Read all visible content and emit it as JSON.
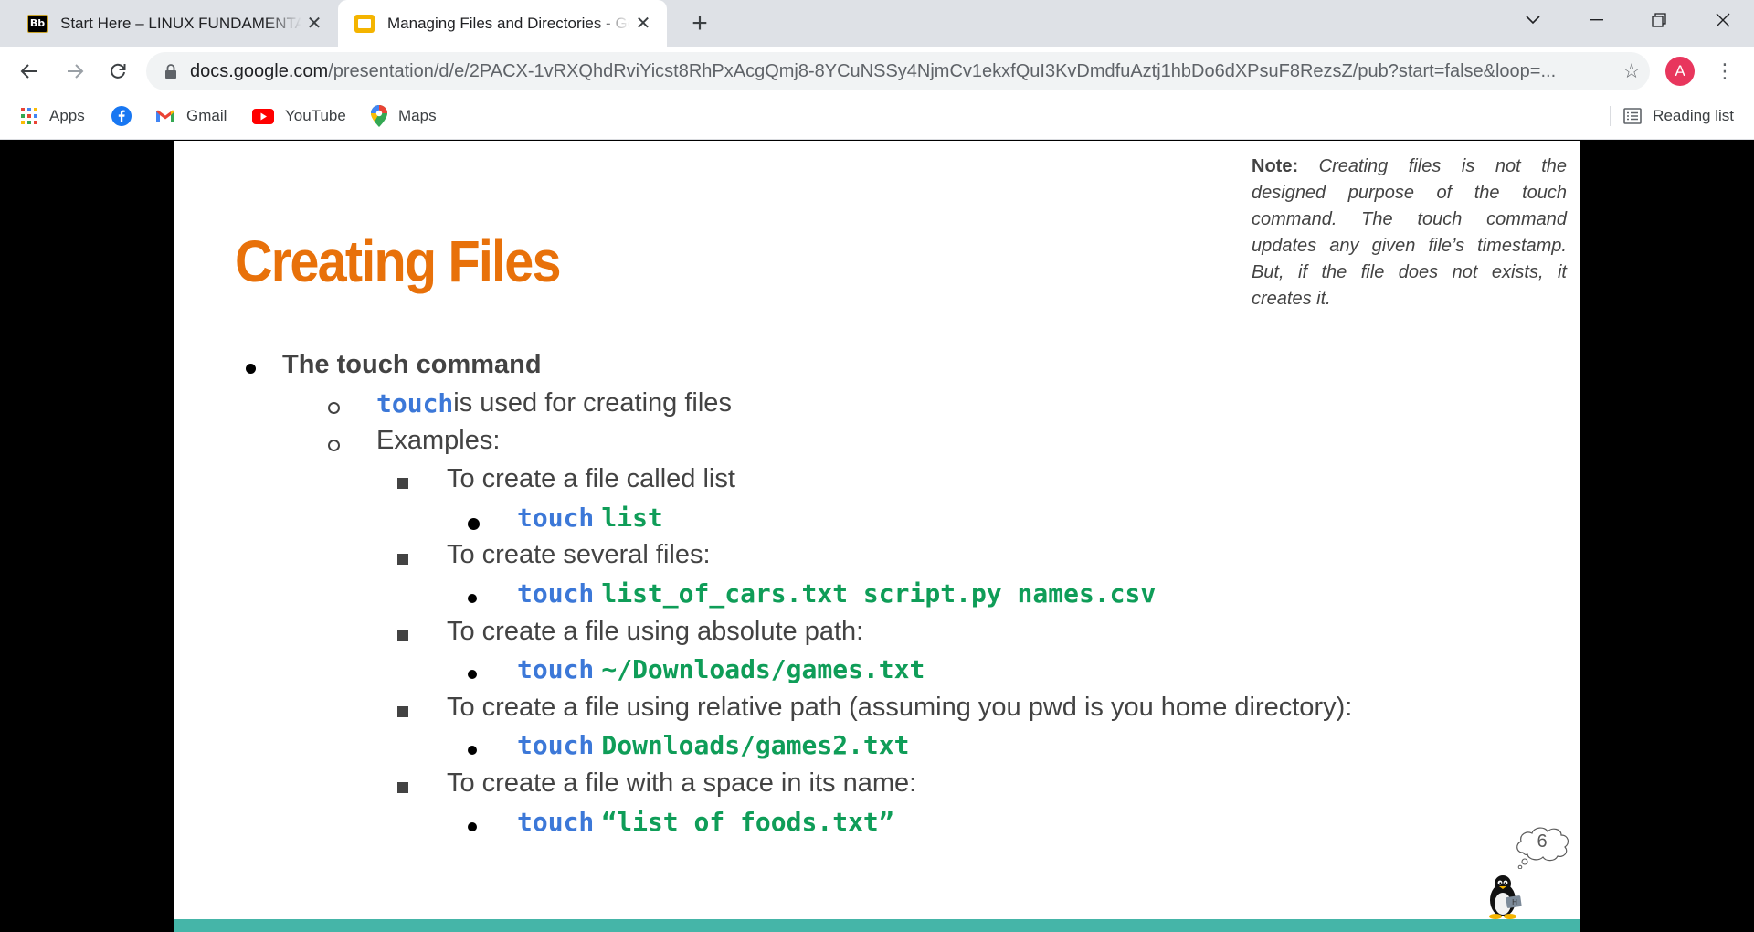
{
  "browser": {
    "tabs": [
      {
        "title": "Start Here – LINUX FUNDAMENTALS",
        "icon": "blackboard-icon",
        "active": false
      },
      {
        "title": "Managing Files and Directories - Google Slides",
        "icon": "google-slides-icon",
        "active": true
      }
    ],
    "address": {
      "domain": "docs.google.com",
      "path": "/presentation/d/e/2PACX-1vRXQhdRviYicst8RhPxAcgQmj8-8YCuNSSy4NjmCv1ekxfQuI3KvDmdfuAztj1hbDo6dXPsuF8RezsZ/pub?start=false&loop=..."
    },
    "profile_initial": "A",
    "bookmarks": [
      {
        "label": "Apps",
        "icon": "apps-grid-icon"
      },
      {
        "label": "",
        "icon": "facebook-icon"
      },
      {
        "label": "Gmail",
        "icon": "gmail-icon"
      },
      {
        "label": "YouTube",
        "icon": "youtube-icon"
      },
      {
        "label": "Maps",
        "icon": "maps-icon"
      }
    ],
    "reading_list": "Reading list"
  },
  "slide": {
    "title": "Creating Files",
    "note": {
      "label": "Note:",
      "text": "Creating files is not the designed purpose of the touch command. The touch command updates any given file’s timestamp. But, if the file does not exists, it creates it."
    },
    "heading": "The touch command",
    "intro": {
      "cmd": "touch",
      "text": " is used for creating files"
    },
    "examples_label": "Examples:",
    "examples": [
      {
        "text": "To create a file called list",
        "cmd": "touch",
        "args": "list"
      },
      {
        "text": "To create several files:",
        "cmd": "touch",
        "args": "list_of_cars.txt script.py names.csv"
      },
      {
        "text": "To create a file using absolute path:",
        "cmd": "touch",
        "args": "~/Downloads/games.txt"
      },
      {
        "text": "To create a file using relative path (assuming you pwd is you home directory):",
        "cmd": "touch",
        "args": "Downloads/games2.txt"
      },
      {
        "text": "To create a file with a space in its name:",
        "cmd": "touch",
        "args": "“list of foods.txt”"
      }
    ],
    "page_number": "6",
    "colors": {
      "title": "#e8710a",
      "command": "#3c78d8",
      "argument": "#0f9d58",
      "footer_bar": "#45b5a8"
    }
  }
}
